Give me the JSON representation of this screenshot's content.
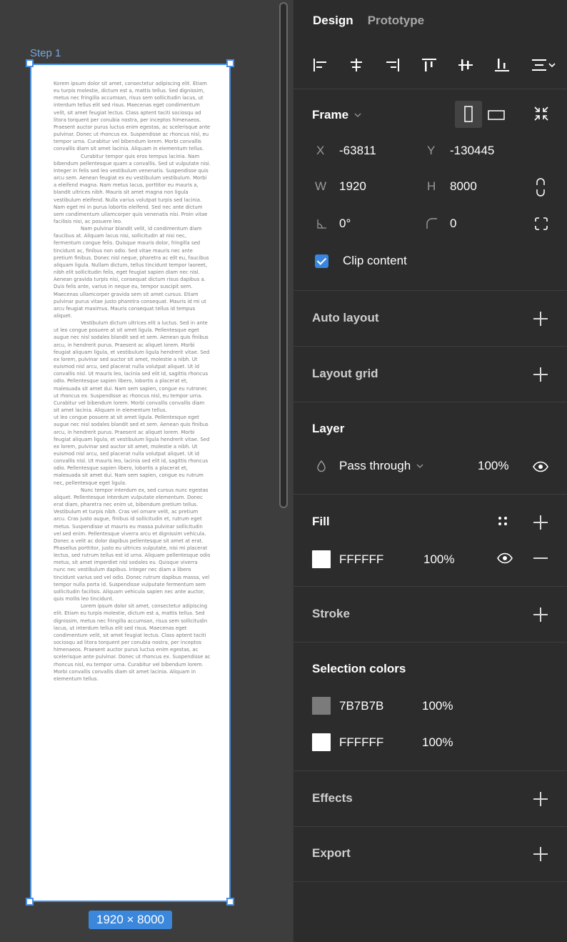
{
  "canvas": {
    "frame_name": "Step 1",
    "size_badge": "1920 × 8000",
    "paragraphs": [
      "Korem ipsum dolor sit amet, consectetur adipiscing elit. Etiam eu turpis molestie, dictum est a, mattis tellus. Sed dignissim, metus nec fringilla accumsan, risus sem sollicitudin lacus, ut interdum tellus elit sed risus. Maecenas eget condimentum velit, sit amet feugiat lectus. Class aptent taciti sociosqu ad litora torquent per conubia nostra, per inceptos himenaeos. Praesent auctor purus luctus enim egestas, ac scelerisque ante pulvinar. Donec ut rhoncus ex. Suspendisse ac rhoncus nisl, eu tempor urna. Curabitur vel bibendum lorem. Morbi convallis convallis diam sit amet lacinia. Aliquam in elementum tellus.",
      "Curabitur tempor quis eros tempus lacinia. Nam bibendum pellentesque quam a convallis. Sed ut vulputate nisi. Integer in felis sed leo vestibulum venenatis. Suspendisse quis arcu sem. Aenean feugiat ex eu vestibulum vestibulum. Morbi a eleifend magna. Nam metus lacus, porttitor eu mauris a, blandit ultrices nibh. Mauris sit amet magna non ligula vestibulum eleifend. Nulla varius volutpat turpis sed lacinia. Nam eget mi in purus lobortis eleifend. Sed nec ante dictum sem condimentum ullamcorper quis venenatis nisi. Proin vitae facilisis nisi, ac posuere leo.",
      "Nam pulvinar blandit velit, id condimentum diam faucibus at. Aliquam lacus nisi, sollicitudin at nisi nec, fermentum congue felis. Quisque mauris dolor, fringilla sed tincidunt ac, finibus non odio. Sed vitae mauris nec ante pretium finibus. Donec nisl neque, pharetra ac elit eu, faucibus aliquam ligula. Nullam dictum, tellus tincidunt tempor laoreet, nibh elit sollicitudin felis, eget feugiat sapien diam nec nisl. Aenean gravida turpis nisi, consequat dictum risus dapibus a. Duis felis ante, varius in neque eu, tempor suscipit sem. Maecenas ullamcorper gravida sem sit amet cursus. Etiam pulvinar purus vitae justo pharetra consequat. Mauris id mi ut arcu feugiat maximus. Mauris consequat tellus id tempus aliquet.",
      "Vestibulum dictum ultrices elit a luctus. Sed in ante ut leo congue posuere at sit amet ligula. Pellentesque eget augue nec nisl sodales blandit sed et sem. Aenean quis finibus arcu, in hendrerit purus. Praesent ac aliquet lorem. Morbi feugiat aliquam ligula, et vestibulum ligula hendrerit vitae. Sed ex lorem, pulvinar sed auctor sit amet, molestie a nibh. Ut euismod nisl arcu, sed placerat nulla volutpat aliquet. Ut id convallis nisl. Ut mauris leo, lacinia sed elit id, sagittis rhoncus odio. Pellentesque sapien libero, lobortis a placerat et, malesuada sit amet dui. Nam sem sapien, congue eu rutronec ut rhoncus ex. Suspendisse ac rhoncus nisl, eu tempor urna. Curabitur vel bibendum lorem. Morbi convallis convallis diam sit amet lacinia. Aliquam in elementum tellus.",
      "ut leo congue posuere at sit amet ligula. Pellentesque eget augue nec nisl sodales blandit sed et sem. Aenean quis finibus arcu, in hendrerit purus. Praesent ac aliquet lorem. Morbi feugiat aliquam ligula, et vestibulum ligula hendrerit vitae. Sed ex lorem, pulvinar sed auctor sit amet, molestie a nibh. Ut euismod nisl arcu, sed placerat nulla volutpat aliquet. Ut id convallis nisl. Ut mauris leo, lacinia sed elit id, sagittis rhoncus odio. Pellentesque sapien libero, lobortis a placerat et, malesuada sit amet dui. Nam sem sapien, congue eu rutrum nec, pellentesque eget ligula.",
      "Nunc tempor interdum ex, sed cursus nunc egestas aliquet. Pellentesque interdum vulputate elementum. Donec erat diam, pharetra nec enim ut, bibendum pretium tellus. Vestibulum et turpis nibh. Cras vel ornare velit, ac pretium arcu. Cras justo augue, finibus id sollicitudin et, rutrum eget metus. Suspendisse ut mauris eu massa pulvinar sollicitudin vel sed enim. Pellentesque viverra arcu et dignissim vehicula. Donec a velit ac dolor dapibus pellentesque sit amet at erat. Phasellus porttitor, justo eu ultrices vulputate, nisi mi placerat lectus, sed rutrum tellus est id urna. Aliquam pellentesque odio metus, sit amet imperdiet nisl sodales eu. Quisque viverra nunc nec vestibulum dapibus. Integer nec diam a libero tincidunt varius sed vel odio. Donec rutrum dapibus massa, vel tempor nulla porta id. Suspendisse vulputate fermentum sem sollicitudin facilisis. Aliquam vehicula sapien nec ante auctor, quis mollis leo tincidunt.",
      "Lorem ipsum dolor sit amet, consectetur adipiscing elit. Etiam eu turpis molestie, dictum est a, mattis tellus. Sed dignissim, metus nec fringilla accumsan, risus sem sollicitudin lacus, ut interdum tellus elit sed risus. Maecenas eget condimentum velit, sit amet feugiat lectus. Class aptent taciti sociosqu ad litora torquent per conubia nostra, per inceptos himenaeos. Praesent auctor purus luctus enim egestas, ac scelerisque ante pulvinar. Donec ut rhoncus ex. Suspendisse ac rhoncus nisl, eu tempor urna. Curabitur vel bibendum lorem. Morbi convallis convallis diam sit amet lacinia. Aliquam in elementum tellus."
    ],
    "paragraph_indent": [
      false,
      true,
      true,
      true,
      false,
      true,
      true
    ]
  },
  "panel": {
    "tabs": {
      "design": "Design",
      "prototype": "Prototype"
    },
    "align_tools": [
      "align-left",
      "align-horizontal-center",
      "align-right",
      "align-top",
      "align-vertical-center",
      "align-bottom",
      "distribute-more"
    ],
    "frame": {
      "title": "Frame",
      "x_label": "X",
      "x_value": "-63811",
      "y_label": "Y",
      "y_value": "-130445",
      "w_label": "W",
      "w_value": "1920",
      "h_label": "H",
      "h_value": "8000",
      "rotation": "0°",
      "radius": "0",
      "clip_content_label": "Clip content",
      "clip_content": true
    },
    "auto_layout": {
      "title": "Auto layout"
    },
    "layout_grid": {
      "title": "Layout grid"
    },
    "layer": {
      "title": "Layer",
      "blend": "Pass through",
      "opacity": "100%"
    },
    "fill": {
      "title": "Fill",
      "color": "FFFFFF",
      "opacity": "100%",
      "swatch": "#FFFFFF"
    },
    "stroke": {
      "title": "Stroke"
    },
    "selection_colors": {
      "title": "Selection colors",
      "items": [
        {
          "hex": "7B7B7B",
          "opacity": "100%",
          "swatch": "#7B7B7B"
        },
        {
          "hex": "FFFFFF",
          "opacity": "100%",
          "swatch": "#FFFFFF"
        }
      ]
    },
    "effects": {
      "title": "Effects"
    },
    "export": {
      "title": "Export"
    }
  },
  "colors": {
    "accent": "#4A90E2",
    "panel_bg": "#2C2C2C",
    "canvas_bg": "#3D3D3D",
    "text_gray": "#7B7B7B"
  }
}
